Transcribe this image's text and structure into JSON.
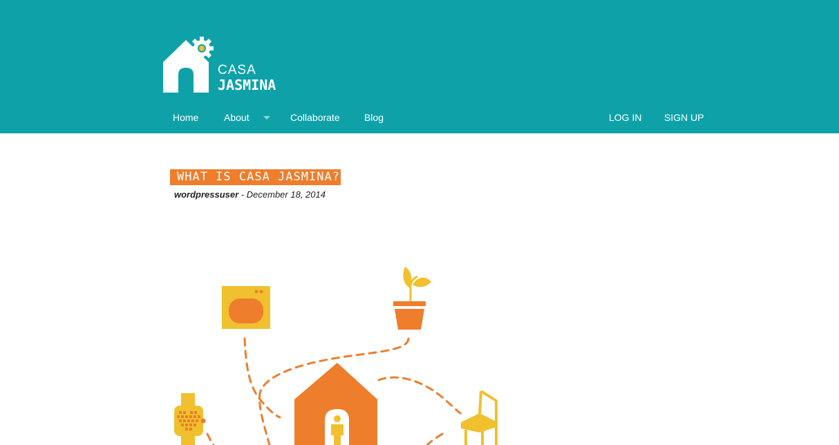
{
  "brand": {
    "line1": "CASA",
    "line2": "JASMINA"
  },
  "nav": {
    "items": [
      {
        "label": "Home"
      },
      {
        "label": "About"
      },
      {
        "label": "Collaborate"
      },
      {
        "label": "Blog"
      }
    ],
    "auth": {
      "login": "LOG IN",
      "signup": "SIGN UP"
    }
  },
  "post": {
    "title": "WHAT IS CASA JASMINA?",
    "author": "wordpressuser",
    "separator": " - ",
    "date": "December 18, 2014"
  },
  "colors": {
    "header_bg": "#0ea2a8",
    "accent_orange": "#ee7d2c",
    "accent_yellow": "#f0c02f"
  },
  "icons": {
    "logo": "house-gear-icon",
    "dropdown": "caret-down-icon"
  }
}
